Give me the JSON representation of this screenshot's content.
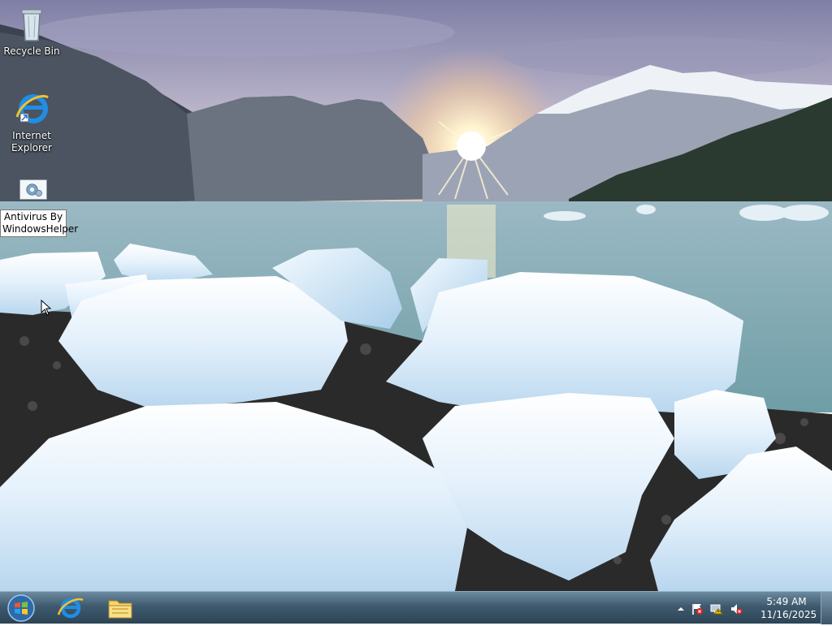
{
  "desktop": {
    "icons": [
      {
        "label": "Recycle Bin",
        "icon": "recycle-bin-icon"
      },
      {
        "label": "Internet Explorer",
        "icon": "internet-explorer-icon"
      },
      {
        "label": "Antivirus By WindowsHelper",
        "icon": "settings-gear-icon"
      }
    ]
  },
  "taskbar": {
    "pinned": [
      {
        "icon": "start-orb-icon"
      },
      {
        "icon": "internet-explorer-icon"
      },
      {
        "icon": "file-explorer-icon"
      }
    ],
    "tray": {
      "icons": [
        "show-hidden-icons-chevron",
        "action-center-flag-icon",
        "network-icon",
        "speaker-muted-icon"
      ],
      "time": "5:49 AM",
      "date": "11/16/2025"
    }
  },
  "colors": {
    "taskbar": "#3f5a6e",
    "sky": "#8a8fb0",
    "water": "#8fb8bf",
    "ice": "#e8f2fa"
  }
}
